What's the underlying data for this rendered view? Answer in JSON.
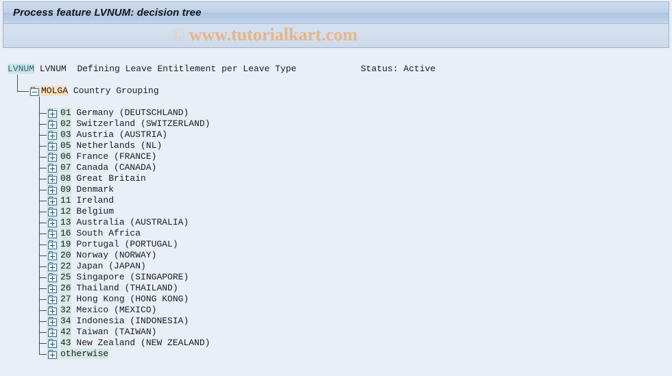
{
  "window": {
    "title": "Process feature LVNUM: decision tree",
    "watermark_copyright": "©",
    "watermark_text": "www.tutorialkart.com"
  },
  "header": {
    "feature_code": "LVNUM",
    "feature_name": "LVNUM",
    "feature_description": "Defining Leave Entitlement per Leave Type",
    "status_label": "Status: Active"
  },
  "tree": {
    "root": {
      "code": "MOLGA",
      "description": "Country Grouping",
      "icon": "folder-minus-icon"
    },
    "nodes": [
      {
        "code": "01",
        "label": "Germany (DEUTSCHLAND)",
        "icon": "folder-plus-icon"
      },
      {
        "code": "02",
        "label": "Switzerland (SWITZERLAND)",
        "icon": "folder-plus-icon"
      },
      {
        "code": "03",
        "label": "Austria (AUSTRIA)",
        "icon": "folder-plus-icon"
      },
      {
        "code": "05",
        "label": "Netherlands (NL)",
        "icon": "folder-plus-icon"
      },
      {
        "code": "06",
        "label": "France (FRANCE)",
        "icon": "folder-plus-icon"
      },
      {
        "code": "07",
        "label": "Canada (CANADA)",
        "icon": "folder-plus-icon"
      },
      {
        "code": "08",
        "label": "Great Britain",
        "icon": "folder-plus-icon"
      },
      {
        "code": "09",
        "label": "Denmark",
        "icon": "folder-plus-icon"
      },
      {
        "code": "11",
        "label": "Ireland",
        "icon": "folder-plus-icon"
      },
      {
        "code": "12",
        "label": "Belgium",
        "icon": "folder-plus-icon"
      },
      {
        "code": "13",
        "label": "Australia (AUSTRALIA)",
        "icon": "folder-plus-icon"
      },
      {
        "code": "16",
        "label": "South Africa",
        "icon": "folder-plus-icon"
      },
      {
        "code": "19",
        "label": "Portugal (PORTUGAL)",
        "icon": "folder-plus-icon"
      },
      {
        "code": "20",
        "label": "Norway (NORWAY)",
        "icon": "folder-plus-icon"
      },
      {
        "code": "22",
        "label": "Japan (JAPAN)",
        "icon": "folder-plus-icon"
      },
      {
        "code": "25",
        "label": "Singapore (SINGAPORE)",
        "icon": "folder-plus-icon"
      },
      {
        "code": "26",
        "label": "Thailand (THAILAND)",
        "icon": "folder-plus-icon"
      },
      {
        "code": "27",
        "label": "Hong Kong (HONG KONG)",
        "icon": "folder-plus-icon"
      },
      {
        "code": "32",
        "label": "Mexico (MEXICO)",
        "icon": "folder-plus-icon"
      },
      {
        "code": "34",
        "label": "Indonesia (INDONESIA)",
        "icon": "folder-plus-icon"
      },
      {
        "code": "42",
        "label": "Taiwan (TAIWAN)",
        "icon": "folder-plus-icon"
      },
      {
        "code": "43",
        "label": "New Zealand (NEW ZEALAND)",
        "icon": "folder-plus-icon"
      },
      {
        "code": "",
        "label": "otherwise",
        "icon": "folder-plus-icon"
      }
    ]
  },
  "colors": {
    "title_bar": "#bed0e8",
    "content_bg": "#e9eff7",
    "highlight_cyan": "#d4e7e3",
    "highlight_peach": "#fbdfbb",
    "watermark": "#e6b483"
  }
}
